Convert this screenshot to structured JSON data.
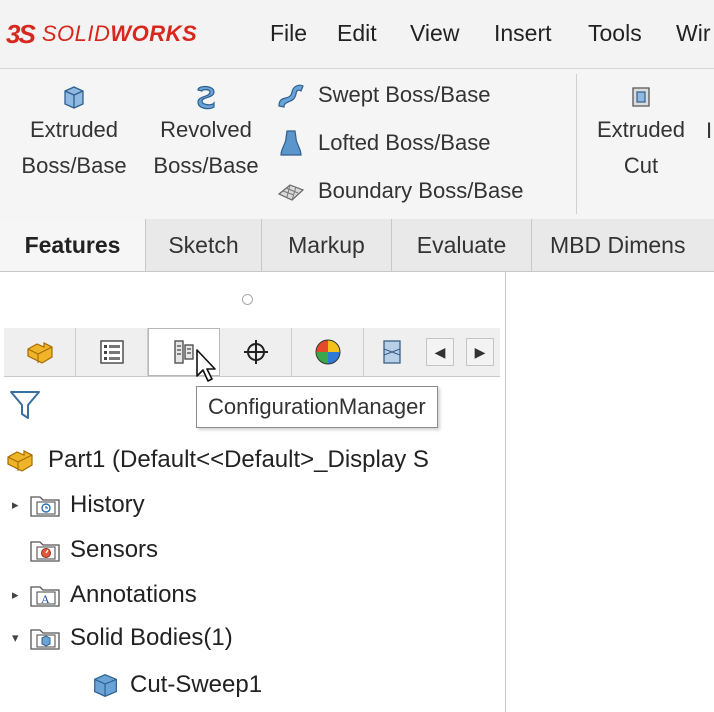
{
  "app": {
    "logo_mark": "3S",
    "logo_text_light": "SOLID",
    "logo_text_bold": "WORKS"
  },
  "menu": [
    "File",
    "Edit",
    "View",
    "Insert",
    "Tools",
    "Wir"
  ],
  "ribbon": {
    "extruded_boss": [
      "Extruded",
      "Boss/Base"
    ],
    "revolved_boss": [
      "Revolved",
      "Boss/Base"
    ],
    "swept_boss": "Swept Boss/Base",
    "lofted_boss": "Lofted Boss/Base",
    "boundary_boss": "Boundary Boss/Base",
    "extruded_cut": [
      "Extruded",
      "Cut"
    ],
    "cut_partial": "I"
  },
  "command_tabs": [
    "Features",
    "Sketch",
    "Markup",
    "Evaluate",
    "MBD Dimens"
  ],
  "panel_tabs": {
    "icons": [
      "featuremanager-icon",
      "propertymanager-icon",
      "configurationmanager-icon",
      "dimxpertmanager-icon",
      "displaymanager-icon",
      "cam-icon"
    ],
    "scroll_left": "◀",
    "scroll_right": "▶"
  },
  "tooltip": "ConfigurationManager",
  "tree": {
    "root": "Part1  (Default<<Default>_Display S",
    "items": [
      {
        "label": "History",
        "caret": "▸",
        "icon": "history-folder-icon"
      },
      {
        "label": "Sensors",
        "caret": "",
        "icon": "sensors-folder-icon"
      },
      {
        "label": "Annotations",
        "caret": "▸",
        "icon": "annotations-folder-icon"
      },
      {
        "label": "Solid Bodies(1)",
        "caret": "▾",
        "icon": "solid-bodies-folder-icon"
      }
    ],
    "child": "Cut-Sweep1"
  },
  "colors": {
    "brand_red": "#d6281e",
    "accent_blue": "#3a7fc1",
    "part_yellow": "#e8a21a"
  }
}
